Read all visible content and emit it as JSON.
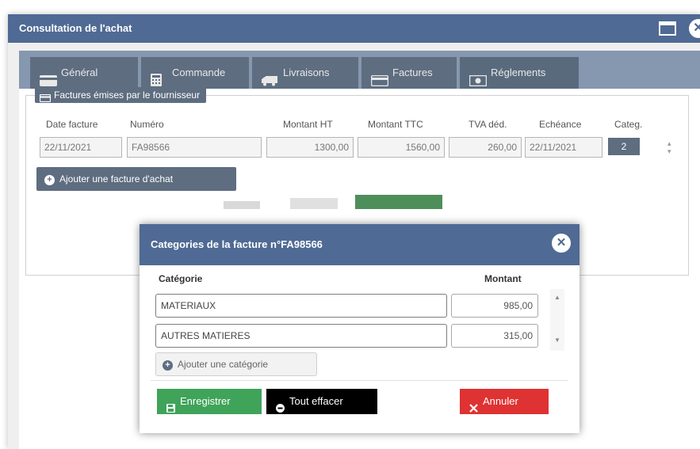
{
  "window": {
    "title": "Consultation de l'achat"
  },
  "tabs": [
    {
      "label": "Général",
      "icon": "card-icon"
    },
    {
      "label": "Commande",
      "icon": "calculator-icon"
    },
    {
      "label": "Livraisons",
      "icon": "truck-icon"
    },
    {
      "label": "Factures",
      "icon": "card-icon"
    },
    {
      "label": "Réglements",
      "icon": "money-icon"
    }
  ],
  "invoices": {
    "legend": "Factures émises par le fournisseur",
    "headers": {
      "date": "Date facture",
      "number": "Numéro",
      "ht": "Montant HT",
      "ttc": "Montant TTC",
      "tva": "TVA déd.",
      "due": "Echéance",
      "categ": "Categ."
    },
    "row": {
      "date": "22/11/2021",
      "number": "FA98566",
      "ht": "1300,00",
      "ttc": "1560,00",
      "tva": "260,00",
      "due": "22/11/2021",
      "categ": "2"
    },
    "add_label": "Ajouter une facture d'achat"
  },
  "modal": {
    "title": "Categories de la facture n°FA98566",
    "col_category": "Catégorie",
    "col_amount": "Montant",
    "rows": [
      {
        "category": "MATERIAUX",
        "amount": "985,00"
      },
      {
        "category": "AUTRES MATIERES",
        "amount": "315,00"
      }
    ],
    "add_label": "Ajouter une catégorie",
    "save_label": "Enregistrer",
    "clear_label": "Tout effacer",
    "cancel_label": "Annuler"
  },
  "colors": {
    "header_blue": "#4f6a94",
    "tab_gray": "#5e6d80",
    "save_green": "#3fa35a",
    "cancel_red": "#df3232"
  }
}
